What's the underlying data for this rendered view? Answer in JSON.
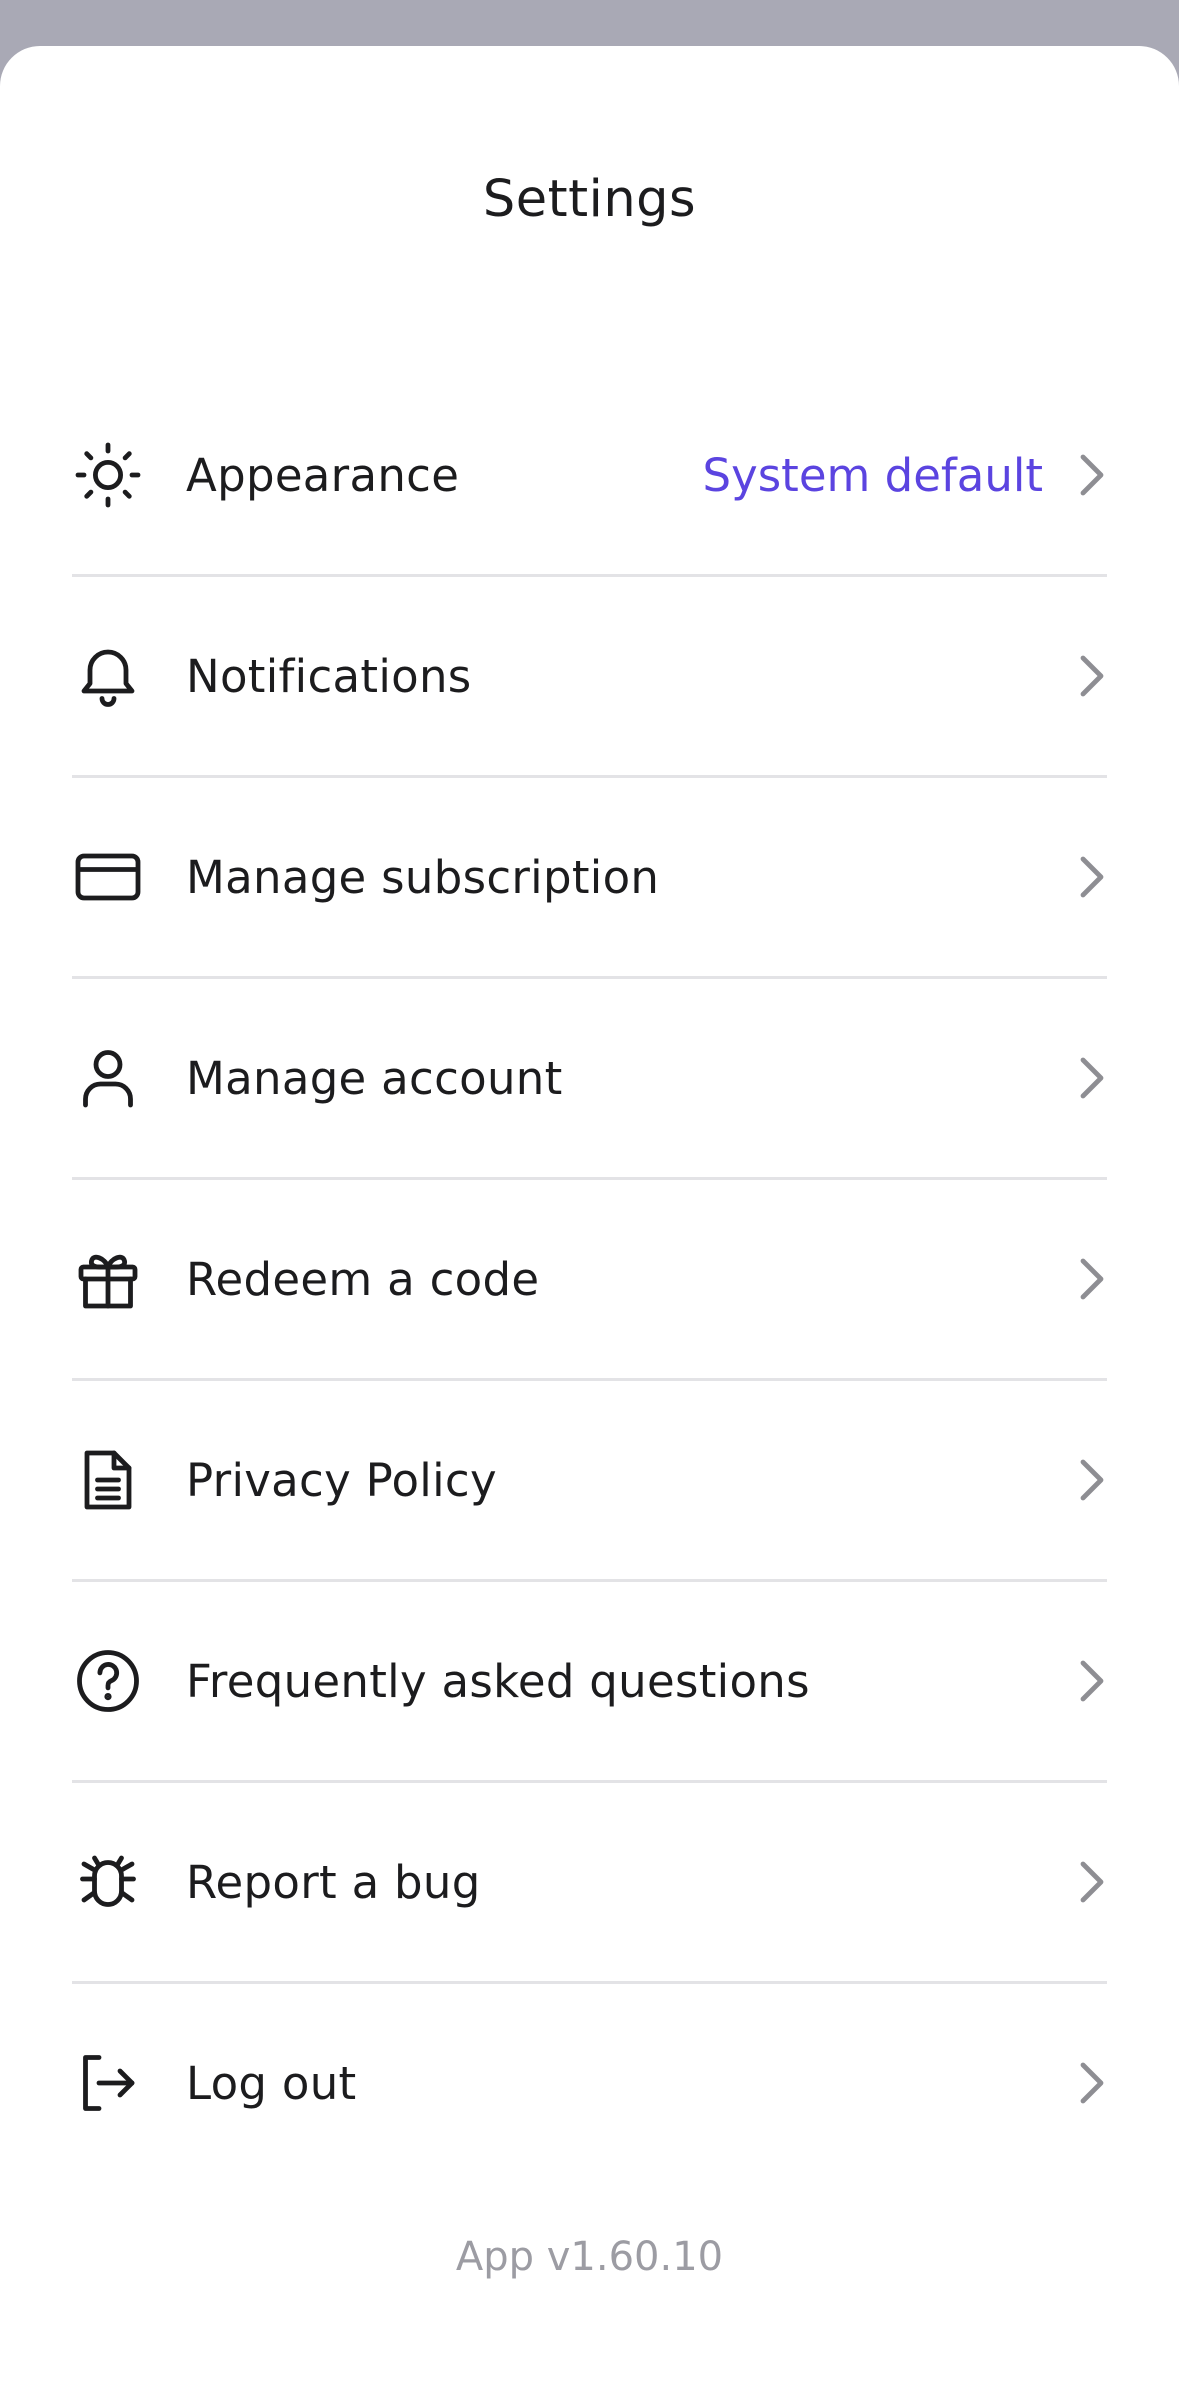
{
  "header": {
    "title": "Settings"
  },
  "settings": {
    "items": [
      {
        "label": "Appearance",
        "value": "System default",
        "icon": "sun-icon"
      },
      {
        "label": "Notifications",
        "value": "",
        "icon": "bell-icon"
      },
      {
        "label": "Manage subscription",
        "value": "",
        "icon": "credit-card-icon"
      },
      {
        "label": "Manage account",
        "value": "",
        "icon": "user-icon"
      },
      {
        "label": "Redeem a code",
        "value": "",
        "icon": "gift-icon"
      },
      {
        "label": "Privacy Policy",
        "value": "",
        "icon": "document-icon"
      },
      {
        "label": "Frequently asked questions",
        "value": "",
        "icon": "help-circle-icon"
      },
      {
        "label": "Report a bug",
        "value": "",
        "icon": "bug-icon"
      },
      {
        "label": "Log out",
        "value": "",
        "icon": "log-out-icon"
      }
    ]
  },
  "footer": {
    "version": "App v1.60.10"
  },
  "colors": {
    "accent": "#5b44e0",
    "text": "#1c1c1e",
    "divider": "#e3e3e6",
    "muted": "#9c9ca3",
    "backdrop": "#a9a9b5"
  }
}
